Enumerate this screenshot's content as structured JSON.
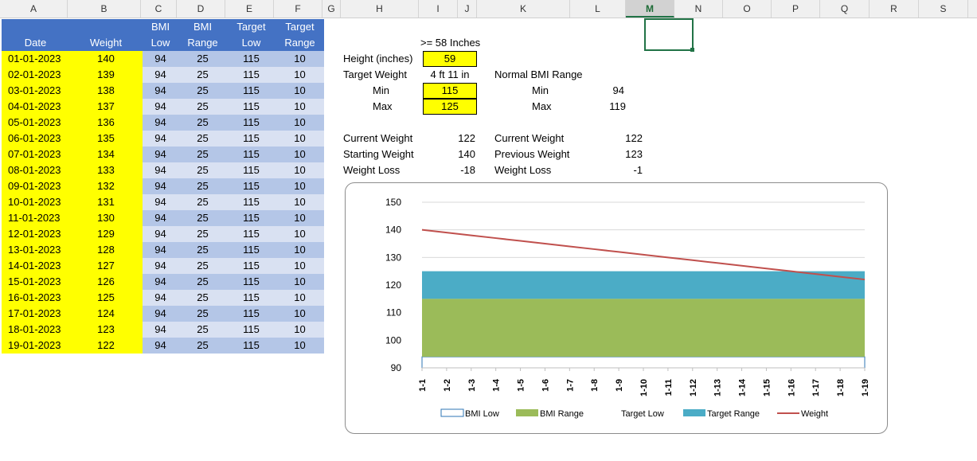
{
  "column_headers": [
    "A",
    "B",
    "C",
    "D",
    "E",
    "F",
    "G",
    "H",
    "I",
    "J",
    "K",
    "L",
    "M",
    "N",
    "O",
    "P",
    "Q",
    "R",
    "S"
  ],
  "selected_column": "M",
  "table": {
    "headers": [
      {
        "line1": "",
        "line2": "Date"
      },
      {
        "line1": "",
        "line2": "Weight"
      },
      {
        "line1": "BMI",
        "line2": "Low"
      },
      {
        "line1": "BMI",
        "line2": "Range"
      },
      {
        "line1": "Target",
        "line2": "Low"
      },
      {
        "line1": "Target",
        "line2": "Range"
      }
    ],
    "rows": [
      [
        "01-01-2023",
        "140",
        "94",
        "25",
        "115",
        "10"
      ],
      [
        "02-01-2023",
        "139",
        "94",
        "25",
        "115",
        "10"
      ],
      [
        "03-01-2023",
        "138",
        "94",
        "25",
        "115",
        "10"
      ],
      [
        "04-01-2023",
        "137",
        "94",
        "25",
        "115",
        "10"
      ],
      [
        "05-01-2023",
        "136",
        "94",
        "25",
        "115",
        "10"
      ],
      [
        "06-01-2023",
        "135",
        "94",
        "25",
        "115",
        "10"
      ],
      [
        "07-01-2023",
        "134",
        "94",
        "25",
        "115",
        "10"
      ],
      [
        "08-01-2023",
        "133",
        "94",
        "25",
        "115",
        "10"
      ],
      [
        "09-01-2023",
        "132",
        "94",
        "25",
        "115",
        "10"
      ],
      [
        "10-01-2023",
        "131",
        "94",
        "25",
        "115",
        "10"
      ],
      [
        "11-01-2023",
        "130",
        "94",
        "25",
        "115",
        "10"
      ],
      [
        "12-01-2023",
        "129",
        "94",
        "25",
        "115",
        "10"
      ],
      [
        "13-01-2023",
        "128",
        "94",
        "25",
        "115",
        "10"
      ],
      [
        "14-01-2023",
        "127",
        "94",
        "25",
        "115",
        "10"
      ],
      [
        "15-01-2023",
        "126",
        "94",
        "25",
        "115",
        "10"
      ],
      [
        "16-01-2023",
        "125",
        "94",
        "25",
        "115",
        "10"
      ],
      [
        "17-01-2023",
        "124",
        "94",
        "25",
        "115",
        "10"
      ],
      [
        "18-01-2023",
        "123",
        "94",
        "25",
        "115",
        "10"
      ],
      [
        "19-01-2023",
        "122",
        "94",
        "25",
        "115",
        "10"
      ]
    ]
  },
  "info": {
    "height_note": ">= 58 Inches",
    "height_label": "Height (inches)",
    "height_value": "59",
    "target_weight_label": "Target Weight",
    "target_weight_value": "4 ft 11 in",
    "min_label": "Min",
    "min_value": "115",
    "max_label": "Max",
    "max_value": "125",
    "normal_bmi_label": "Normal BMI Range",
    "bmi_min_label": "Min",
    "bmi_min_value": "94",
    "bmi_max_label": "Max",
    "bmi_max_value": "119",
    "current_weight_label": "Current Weight",
    "current_weight_value": "122",
    "starting_weight_label": "Starting Weight",
    "starting_weight_value": "140",
    "weight_loss_label": "Weight Loss",
    "weight_loss_value": "-18",
    "current_weight2_label": "Current Weight",
    "current_weight2_value": "122",
    "previous_weight_label": "Previous Weight",
    "previous_weight_value": "123",
    "weight_loss2_label": "Weight Loss",
    "weight_loss2_value": "-1"
  },
  "chart_data": {
    "type": "area",
    "categories": [
      "1-1",
      "1-2",
      "1-3",
      "1-4",
      "1-5",
      "1-6",
      "1-7",
      "1-8",
      "1-9",
      "1-10",
      "1-11",
      "1-12",
      "1-13",
      "1-14",
      "1-15",
      "1-16",
      "1-17",
      "1-18",
      "1-19"
    ],
    "ylim": [
      90,
      150
    ],
    "yticks": [
      90,
      100,
      110,
      120,
      130,
      140,
      150
    ],
    "grid": true,
    "legend_position": "bottom",
    "series": [
      {
        "name": "BMI Low",
        "kind": "stacked-area",
        "color": "#ffffff",
        "stroke": "#2e75b6",
        "values": [
          94,
          94,
          94,
          94,
          94,
          94,
          94,
          94,
          94,
          94,
          94,
          94,
          94,
          94,
          94,
          94,
          94,
          94,
          94
        ]
      },
      {
        "name": "BMI Range",
        "kind": "stacked-area",
        "color": "#9bbb59",
        "values": [
          25,
          25,
          25,
          25,
          25,
          25,
          25,
          25,
          25,
          25,
          25,
          25,
          25,
          25,
          25,
          25,
          25,
          25,
          25
        ]
      },
      {
        "name": "Target Low",
        "kind": "area",
        "color": "none",
        "values": [
          115,
          115,
          115,
          115,
          115,
          115,
          115,
          115,
          115,
          115,
          115,
          115,
          115,
          115,
          115,
          115,
          115,
          115,
          115
        ]
      },
      {
        "name": "Target Range",
        "kind": "stacked-area",
        "color": "#4bacc6",
        "values": [
          10,
          10,
          10,
          10,
          10,
          10,
          10,
          10,
          10,
          10,
          10,
          10,
          10,
          10,
          10,
          10,
          10,
          10,
          10
        ]
      },
      {
        "name": "Weight",
        "kind": "line",
        "color": "#c0504d",
        "values": [
          140,
          139,
          138,
          137,
          136,
          135,
          134,
          133,
          132,
          131,
          130,
          129,
          128,
          127,
          126,
          125,
          124,
          123,
          122
        ]
      }
    ]
  }
}
